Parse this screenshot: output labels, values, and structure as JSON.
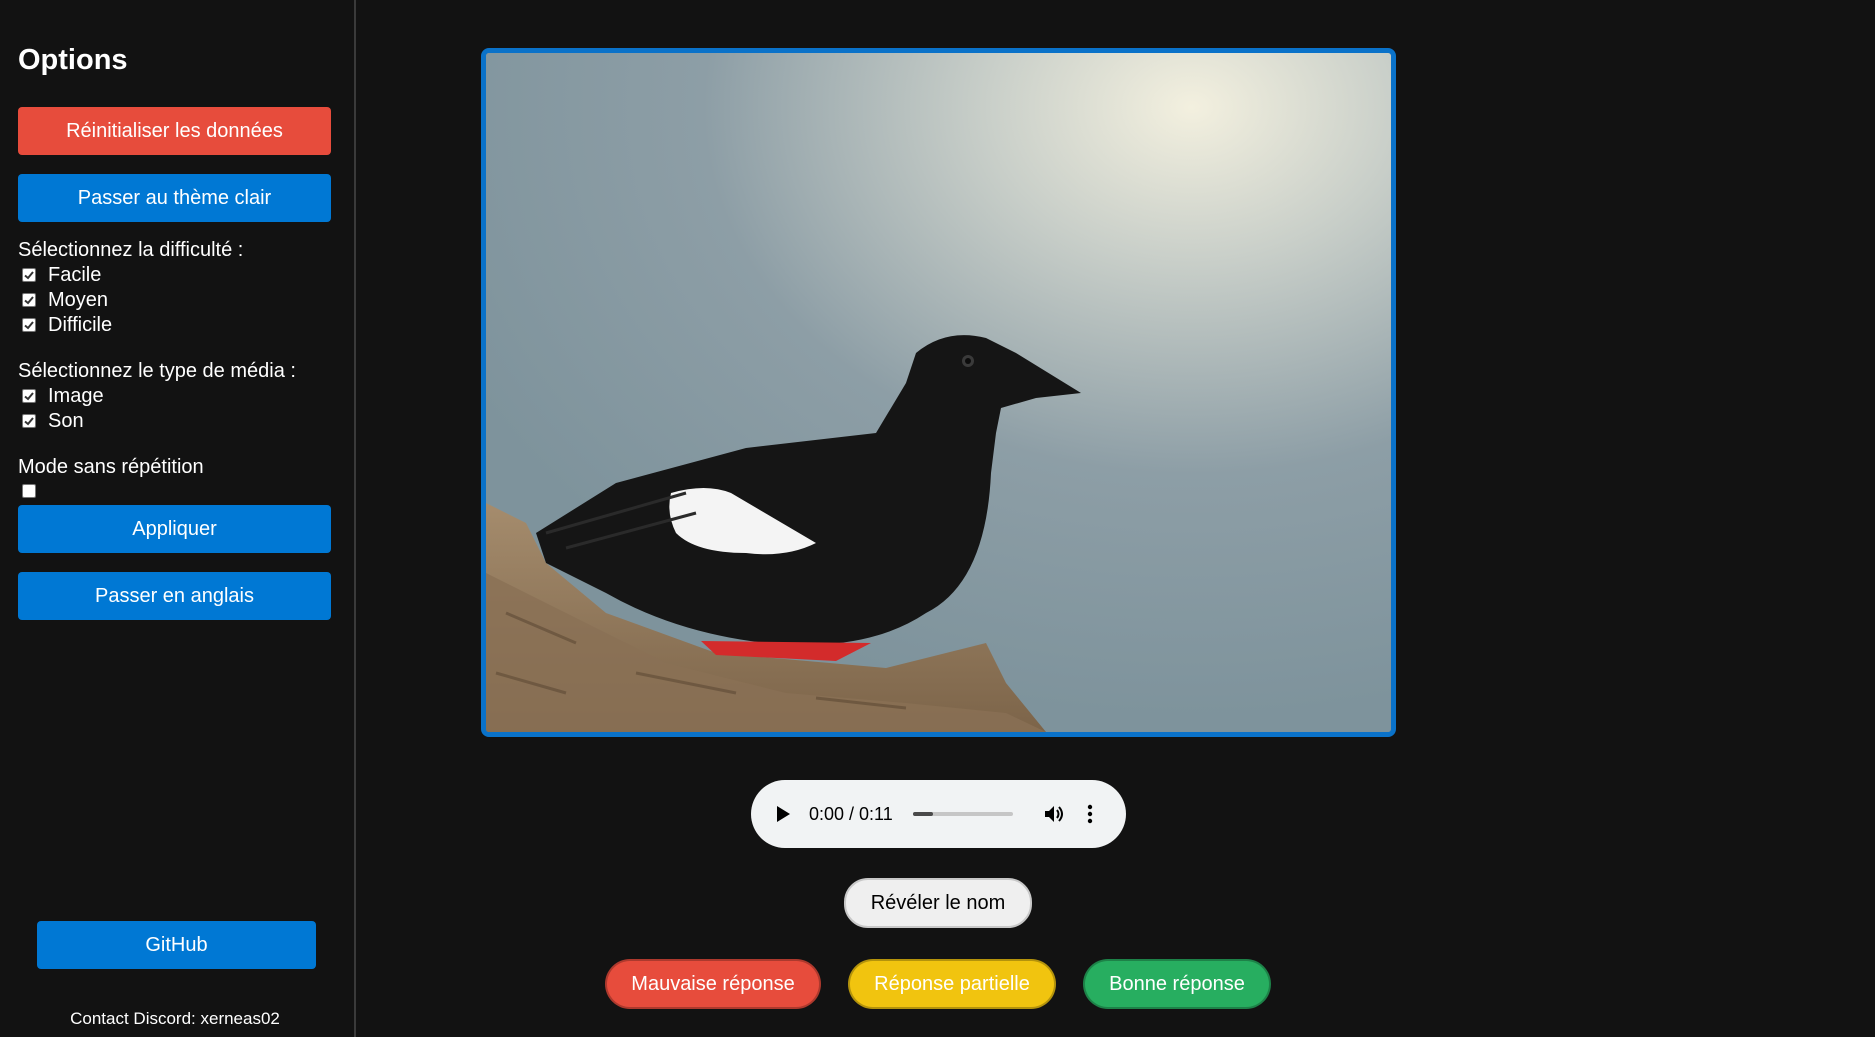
{
  "sidebar": {
    "title": "Options",
    "reset_label": "Réinitialiser les données",
    "theme_label": "Passer au thème clair",
    "difficulty_heading": "Sélectionnez la difficulté :",
    "difficulty_options": [
      {
        "label": "Facile",
        "checked": true
      },
      {
        "label": "Moyen",
        "checked": true
      },
      {
        "label": "Difficile",
        "checked": true
      }
    ],
    "media_heading": "Sélectionnez le type de média :",
    "media_options": [
      {
        "label": "Image",
        "checked": true
      },
      {
        "label": "Son",
        "checked": true
      }
    ],
    "no_repeat_label": "Mode sans répétition",
    "no_repeat_checked": false,
    "apply_label": "Appliquer",
    "language_label": "Passer en anglais",
    "github_label": "GitHub",
    "contact_text": "Contact Discord: xerneas02"
  },
  "audio": {
    "time": "0:00 / 0:11",
    "progress": 0.2
  },
  "reveal_label": "Révéler le nom",
  "answers": {
    "wrong": "Mauvaise réponse",
    "partial": "Réponse partielle",
    "right": "Bonne réponse"
  },
  "colors": {
    "accent": "#0078d4",
    "danger": "#e74c3c",
    "warning": "#f1c40f",
    "success": "#27ae60",
    "background": "#121212"
  }
}
